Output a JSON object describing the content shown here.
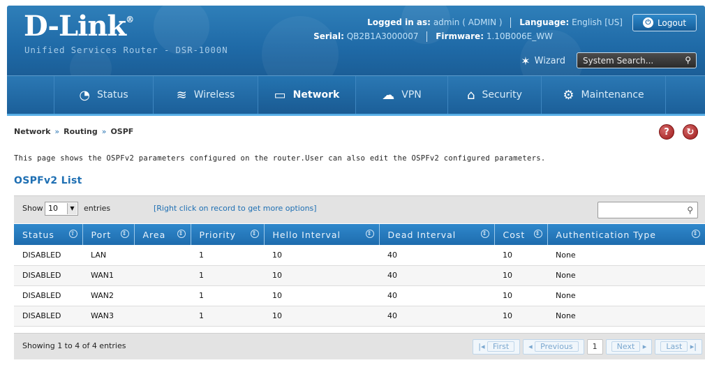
{
  "brand": {
    "logo": "D-Link",
    "logo_mark": "®",
    "product": "Unified Services Router - DSR-1000N"
  },
  "session": {
    "logged_in_label": "Logged in as:",
    "user": "admin ( ADMIN )",
    "language_label": "Language:",
    "language": "English [US]",
    "serial_label": "Serial:",
    "serial": "QB2B1A3000007",
    "firmware_label": "Firmware:",
    "firmware": "1.10B006E_WW",
    "logout_label": "Logout"
  },
  "tools": {
    "wizard_label": "Wizard",
    "search_placeholder": "System Search..."
  },
  "nav": {
    "items": [
      {
        "label": "Status",
        "icon": "gauge-icon"
      },
      {
        "label": "Wireless",
        "icon": "wifi-icon"
      },
      {
        "label": "Network",
        "icon": "monitor-icon"
      },
      {
        "label": "VPN",
        "icon": "cloud-lock-icon"
      },
      {
        "label": "Security",
        "icon": "lock-icon"
      },
      {
        "label": "Maintenance",
        "icon": "gears-icon"
      }
    ],
    "active": "Network"
  },
  "breadcrumb": {
    "items": [
      "Network",
      "Routing",
      "OSPF"
    ],
    "separator": "»"
  },
  "page": {
    "description": "This page shows the OSPFv2 parameters configured on the router.User can also edit the OSPFv2 configured parameters.",
    "list_title": "OSPFv2 List"
  },
  "table_controls": {
    "show_label": "Show",
    "page_size": "10",
    "entries_label": "entries",
    "hint": "[Right click on record to get more options]"
  },
  "table": {
    "columns": [
      "Status",
      "Port",
      "Area",
      "Priority",
      "Hello Interval",
      "Dead Interval",
      "Cost",
      "Authentication Type"
    ],
    "rows": [
      [
        "DISABLED",
        "LAN",
        "",
        "1",
        "10",
        "40",
        "10",
        "None"
      ],
      [
        "DISABLED",
        "WAN1",
        "",
        "1",
        "10",
        "40",
        "10",
        "None"
      ],
      [
        "DISABLED",
        "WAN2",
        "",
        "1",
        "10",
        "40",
        "10",
        "None"
      ],
      [
        "DISABLED",
        "WAN3",
        "",
        "1",
        "10",
        "40",
        "10",
        "None"
      ]
    ]
  },
  "footer": {
    "showing": "Showing 1 to 4 of 4 entries",
    "first": "First",
    "previous": "Previous",
    "current_page": "1",
    "next": "Next",
    "last": "Last"
  },
  "colors": {
    "header_blue": "#1f6aa7",
    "table_header": "#2f88cc",
    "accent_text": "#1e6fb3",
    "help_red": "#9e1b1b"
  }
}
